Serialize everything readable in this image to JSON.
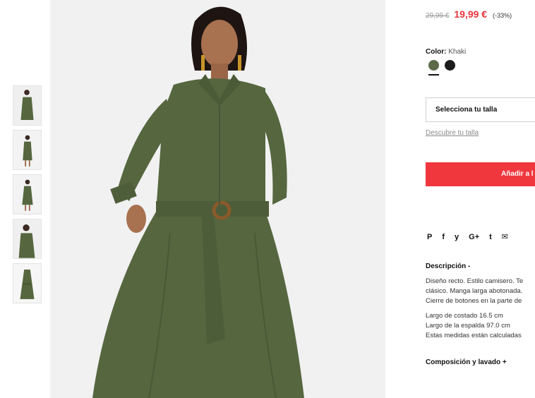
{
  "gallery": {
    "thumbnails": [
      "thumb-1",
      "thumb-2",
      "thumb-3",
      "thumb-4",
      "thumb-5"
    ]
  },
  "product": {
    "old_price": "29,99 €",
    "price": "19,99 €",
    "discount": "(-33%)",
    "color_label": "Color:",
    "color_value": "Khaki",
    "colors": [
      "#5b6a48",
      "#1c1c1c"
    ],
    "size_select": "Selecciona tu talla",
    "size_guide": "Descubre tu talla",
    "add_button": "Añadir a l",
    "share_icons": [
      "P",
      "f",
      "y",
      "G+",
      "t",
      "✉"
    ]
  },
  "description": {
    "title": "Descripción -",
    "lines": [
      "Diseño recto. Estilo camisero. Te",
      "clásico. Manga larga abotonada.",
      "Cierre de botones en la parte de"
    ],
    "measures": [
      "Largo de costado 16.5 cm",
      "Largo de la espalda 97.0 cm",
      "Estas medidas están calculadas"
    ],
    "composition_title": "Composición y lavado +"
  },
  "colors": {
    "accent": "#f0373e",
    "dress": "#56663f"
  }
}
